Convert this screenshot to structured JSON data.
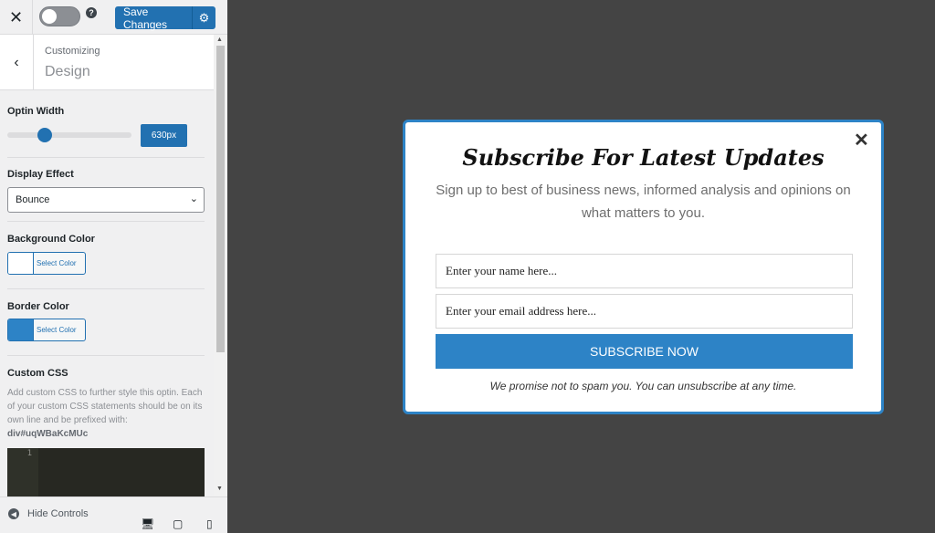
{
  "topbar": {
    "close_icon": "close-icon",
    "help_icon": "question-icon",
    "save_label": "Save Changes",
    "settings_icon": "gear-icon"
  },
  "section": {
    "breadcrumb": "Customizing",
    "title": "Design"
  },
  "controls": {
    "optin_width": {
      "label": "Optin Width",
      "value": "630px"
    },
    "display_effect": {
      "label": "Display Effect",
      "selected": "Bounce"
    },
    "background_color": {
      "label": "Background Color",
      "button_label": "Select Color",
      "color": "#ffffff"
    },
    "border_color": {
      "label": "Border Color",
      "button_label": "Select Color",
      "color": "#2d83c6"
    },
    "custom_css": {
      "label": "Custom CSS",
      "description": "Add custom CSS to further style this optin. Each of your custom CSS statements should be on its own line and be prefixed with:",
      "selector": "div#uqWBaKcMUc",
      "line_number": "1"
    }
  },
  "footer": {
    "hide_controls": "Hide Controls"
  },
  "optin": {
    "title": "Subscribe For Latest Updates",
    "description": "Sign up to best of business news, informed analysis and opinions on what matters to you.",
    "name_placeholder": "Enter your name here...",
    "email_placeholder": "Enter your email address here...",
    "submit_label": "SUBSCRIBE NOW",
    "note": "We promise not to spam you. You can unsubscribe at any time.",
    "accent_color": "#2d83c6"
  },
  "colors": {
    "primary": "#2271b1",
    "canvas_bg": "#444444"
  }
}
